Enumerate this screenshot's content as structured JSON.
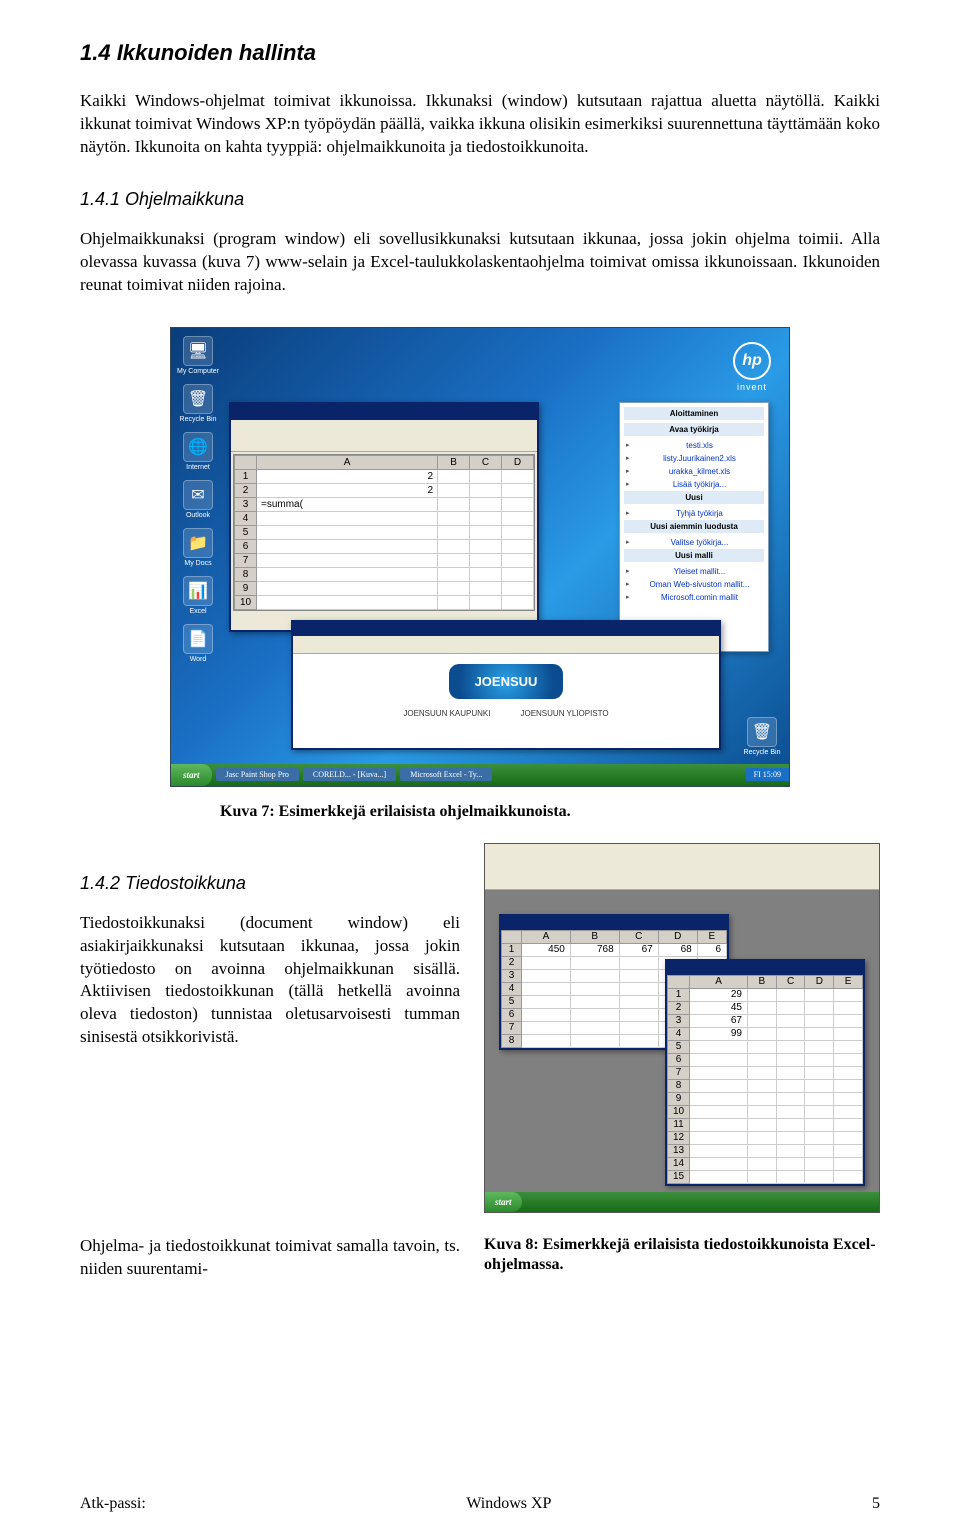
{
  "heading14": "1.4   Ikkunoiden hallinta",
  "p1": "Kaikki Windows-ohjelmat toimivat ikkunoissa. Ikkunaksi (window) kutsutaan rajattua aluetta näytöllä. Kaikki ikkunat toimivat Windows XP:n työpöydän päällä, vaikka ikkuna olisikin esimerkiksi suurennettuna täyttämään koko näytön. Ikkunoita on kahta tyyppiä: ohjelmaikkunoita ja tiedostoikkunoita.",
  "heading141": "1.4.1   Ohjelmaikkuna",
  "p2": "Ohjelmaikkunaksi (program window) eli sovellusikkunaksi kutsutaan ikkunaa, jossa jokin ohjelma toimii. Alla olevassa kuvassa (kuva 7) www-selain ja Excel-taulukkolaskentaohjelma toimivat omissa ikkunoissaan. Ikkunoiden reunat toimivat niiden rajoina.",
  "desktopIcons": [
    "My Computer",
    "Recycle Bin",
    "Internet",
    "Outlook",
    "My Docs",
    "Excel",
    "Word"
  ],
  "hp": {
    "mark": "hp",
    "sub": "invent"
  },
  "excelCols": [
    "",
    "A",
    "B",
    "C",
    "D"
  ],
  "excelRows": [
    {
      "n": "1",
      "a": "2",
      "b": "",
      "c": "",
      "d": ""
    },
    {
      "n": "2",
      "a": "2",
      "b": "",
      "c": "",
      "d": ""
    },
    {
      "n": "3",
      "a": "=summa(",
      "b": "",
      "c": "",
      "d": ""
    },
    {
      "n": "4",
      "a": "",
      "b": "",
      "c": "",
      "d": ""
    },
    {
      "n": "5",
      "a": "",
      "b": "",
      "c": "",
      "d": ""
    },
    {
      "n": "6",
      "a": "",
      "b": "",
      "c": "",
      "d": ""
    },
    {
      "n": "7",
      "a": "",
      "b": "",
      "c": "",
      "d": ""
    },
    {
      "n": "8",
      "a": "",
      "b": "",
      "c": "",
      "d": ""
    },
    {
      "n": "9",
      "a": "",
      "b": "",
      "c": "",
      "d": ""
    },
    {
      "n": "10",
      "a": "",
      "b": "",
      "c": "",
      "d": ""
    }
  ],
  "paneHdr": "Aloittaminen",
  "paneSections": [
    {
      "title": "Avaa työkirja",
      "items": [
        "testi.xls",
        "listy.Juurikainen2.xls",
        "urakka_kilmet.xls",
        "Lisää työkirja..."
      ]
    },
    {
      "title": "Uusi",
      "items": [
        "Tyhjä työkirja"
      ]
    },
    {
      "title": "Uusi aiemmin luodusta",
      "items": [
        "Valitse työkirja..."
      ]
    },
    {
      "title": "Uusi malli",
      "items": [
        "Yleiset mallit...",
        "Oman Web-sivuston mallit...",
        "Microsoft.comin mallit"
      ]
    }
  ],
  "browserLogo": "JOENSUU",
  "browserSub1": "JOENSUUN KAUPUNKI",
  "browserSub2": "JOENSUUN YLIOPISTO",
  "startLabel": "start",
  "taskItems": [
    "Jasc Paint Shop Pro",
    "CORELD... - [Kuva...]",
    "Microsoft Excel - Ty..."
  ],
  "trayText": "FI  15:09",
  "caption7": "Kuva 7: Esimerkkejä erilaisista ohjelmaikkunoista.",
  "heading142": "1.4.2   Tiedostoikkuna",
  "p3": "Tiedostoikkunaksi (document window) eli asiakirjaikkunaksi kutsutaan ikkunaa, jossa jokin työtiedosto on avoinna ohjelmaikkunan sisällä. Aktiivisen tiedostoikkunan (tällä hetkellä avoinna oleva tiedoston) tunnistaa oletusarvoisesti tumman sinisestä otsikkorivistä.",
  "doc1": {
    "cols": [
      "",
      "A",
      "B",
      "C",
      "D",
      "E"
    ],
    "rows": [
      {
        "n": "1",
        "a": "450",
        "b": "768",
        "c": "67",
        "d": "68",
        "e": "6"
      },
      {
        "n": "2"
      },
      {
        "n": "3"
      },
      {
        "n": "4"
      },
      {
        "n": "5"
      },
      {
        "n": "6"
      },
      {
        "n": "7"
      },
      {
        "n": "8"
      }
    ]
  },
  "doc2": {
    "cols": [
      "",
      "A",
      "B",
      "C",
      "D",
      "E"
    ],
    "rows": [
      {
        "n": "1",
        "a": "29"
      },
      {
        "n": "2",
        "a": "45"
      },
      {
        "n": "3",
        "a": "67"
      },
      {
        "n": "4",
        "a": "99"
      },
      {
        "n": "5"
      },
      {
        "n": "6"
      },
      {
        "n": "7"
      },
      {
        "n": "8"
      },
      {
        "n": "9"
      },
      {
        "n": "10"
      },
      {
        "n": "11"
      },
      {
        "n": "12"
      },
      {
        "n": "13"
      },
      {
        "n": "14"
      },
      {
        "n": "15"
      }
    ]
  },
  "p4": "Ohjelma- ja tiedostoikkunat toimivat samalla tavoin, ts. niiden suurentami-",
  "caption8": "Kuva 8: Esimerkkejä erilaisista tiedostoikkunoista Excel-ohjelmassa.",
  "footerLeft": "Atk-passi:",
  "footerCenter": "Windows XP",
  "footerRight": "5"
}
